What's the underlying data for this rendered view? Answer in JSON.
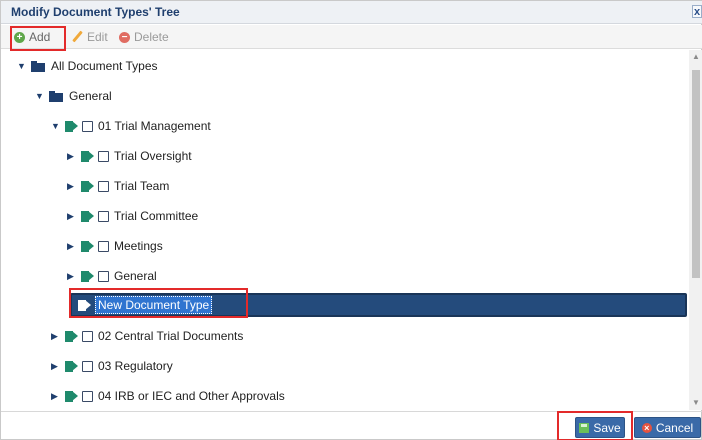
{
  "dialog": {
    "title": "Modify Document Types' Tree",
    "close_label": "x"
  },
  "toolbar": {
    "add_label": "Add",
    "edit_label": "Edit",
    "delete_label": "Delete"
  },
  "tree": {
    "root": {
      "label": "All Document Types",
      "expanded": true
    },
    "general": {
      "label": "General",
      "expanded": true
    },
    "trial_management": {
      "label": "01 Trial Management",
      "expanded": true
    },
    "children": [
      {
        "label": "Trial Oversight"
      },
      {
        "label": "Trial Team"
      },
      {
        "label": "Trial Committee"
      },
      {
        "label": "Meetings"
      },
      {
        "label": "General"
      }
    ],
    "new_node_value": "New Document Type",
    "siblings": [
      {
        "label": "02 Central Trial Documents"
      },
      {
        "label": "03 Regulatory"
      },
      {
        "label": "04 IRB or IEC and Other Approvals"
      }
    ]
  },
  "footer": {
    "save_label": "Save",
    "cancel_label": "Cancel"
  },
  "colors": {
    "title_text": "#1f3f6e",
    "tag_icon": "#1f8a6c",
    "selected_row": "#244b7c",
    "highlight_box": "#e32a2a",
    "button_bg": "#3a6aa8"
  }
}
